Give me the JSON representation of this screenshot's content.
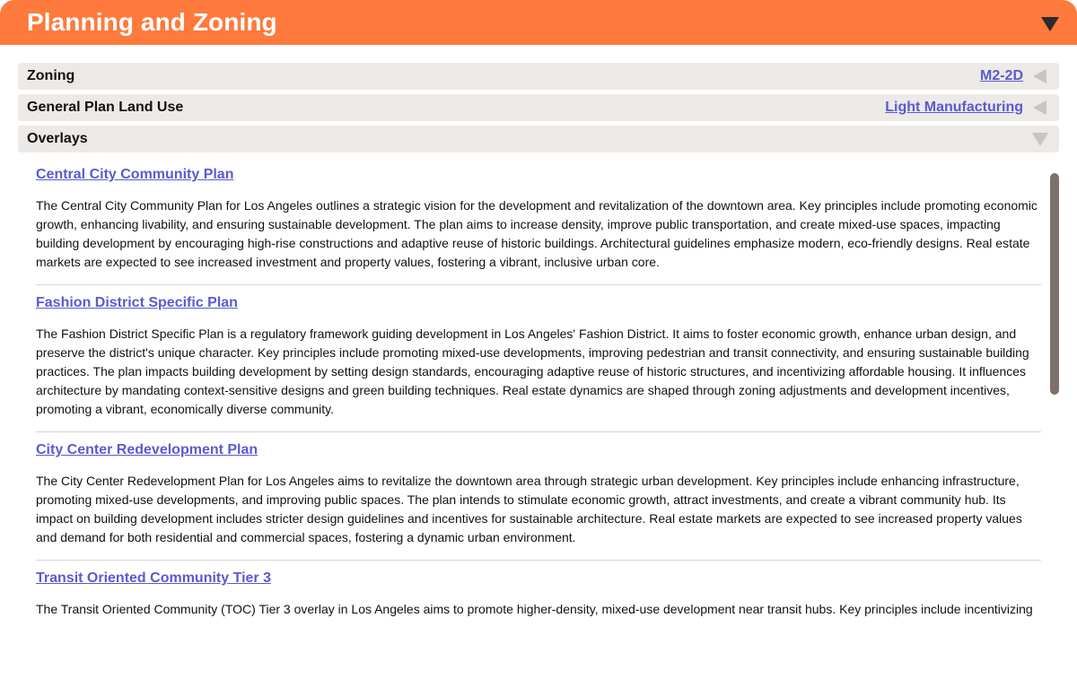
{
  "header": {
    "title": "Planning and Zoning",
    "toggle_icon": "triangle-down-icon",
    "background_color": "#ff7a3d"
  },
  "rows": [
    {
      "label": "Zoning",
      "value": "M2-2D",
      "icon": "triangle-left-icon"
    },
    {
      "label": "General Plan Land Use",
      "value": "Light Manufacturing",
      "icon": "triangle-left-icon"
    },
    {
      "label": "Overlays",
      "value": "",
      "icon": "triangle-down-icon"
    }
  ],
  "overlays": [
    {
      "title": "Central City Community Plan",
      "description": "The Central City Community Plan for Los Angeles outlines a strategic vision for the development and revitalization of the downtown area. Key principles include promoting economic growth, enhancing livability, and ensuring sustainable development. The plan aims to increase density, improve public transportation, and create mixed-use spaces, impacting building development by encouraging high-rise constructions and adaptive reuse of historic buildings. Architectural guidelines emphasize modern, eco-friendly designs. Real estate markets are expected to see increased investment and property values, fostering a vibrant, inclusive urban core."
    },
    {
      "title": "Fashion District Specific Plan",
      "description": "The Fashion District Specific Plan is a regulatory framework guiding development in Los Angeles' Fashion District. It aims to foster economic growth, enhance urban design, and preserve the district's unique character. Key principles include promoting mixed-use developments, improving pedestrian and transit connectivity, and ensuring sustainable building practices. The plan impacts building development by setting design standards, encouraging adaptive reuse of historic structures, and incentivizing affordable housing. It influences architecture by mandating context-sensitive designs and green building techniques. Real estate dynamics are shaped through zoning adjustments and development incentives, promoting a vibrant, economically diverse community."
    },
    {
      "title": "City Center Redevelopment Plan",
      "description": "The City Center Redevelopment Plan for Los Angeles aims to revitalize the downtown area through strategic urban development. Key principles include enhancing infrastructure, promoting mixed-use developments, and improving public spaces. The plan intends to stimulate economic growth, attract investments, and create a vibrant community hub. Its impact on building development includes stricter design guidelines and incentives for sustainable architecture. Real estate markets are expected to see increased property values and demand for both residential and commercial spaces, fostering a dynamic urban environment."
    },
    {
      "title": "Transit Oriented Community Tier 3",
      "description": "The Transit Oriented Community (TOC) Tier 3 overlay in Los Angeles aims to promote higher-density, mixed-use development near transit hubs. Key principles include incentivizing"
    }
  ],
  "colors": {
    "link": "#5a5ad0",
    "row_background": "#ece9e7",
    "scrollbar": "#7e706b"
  }
}
